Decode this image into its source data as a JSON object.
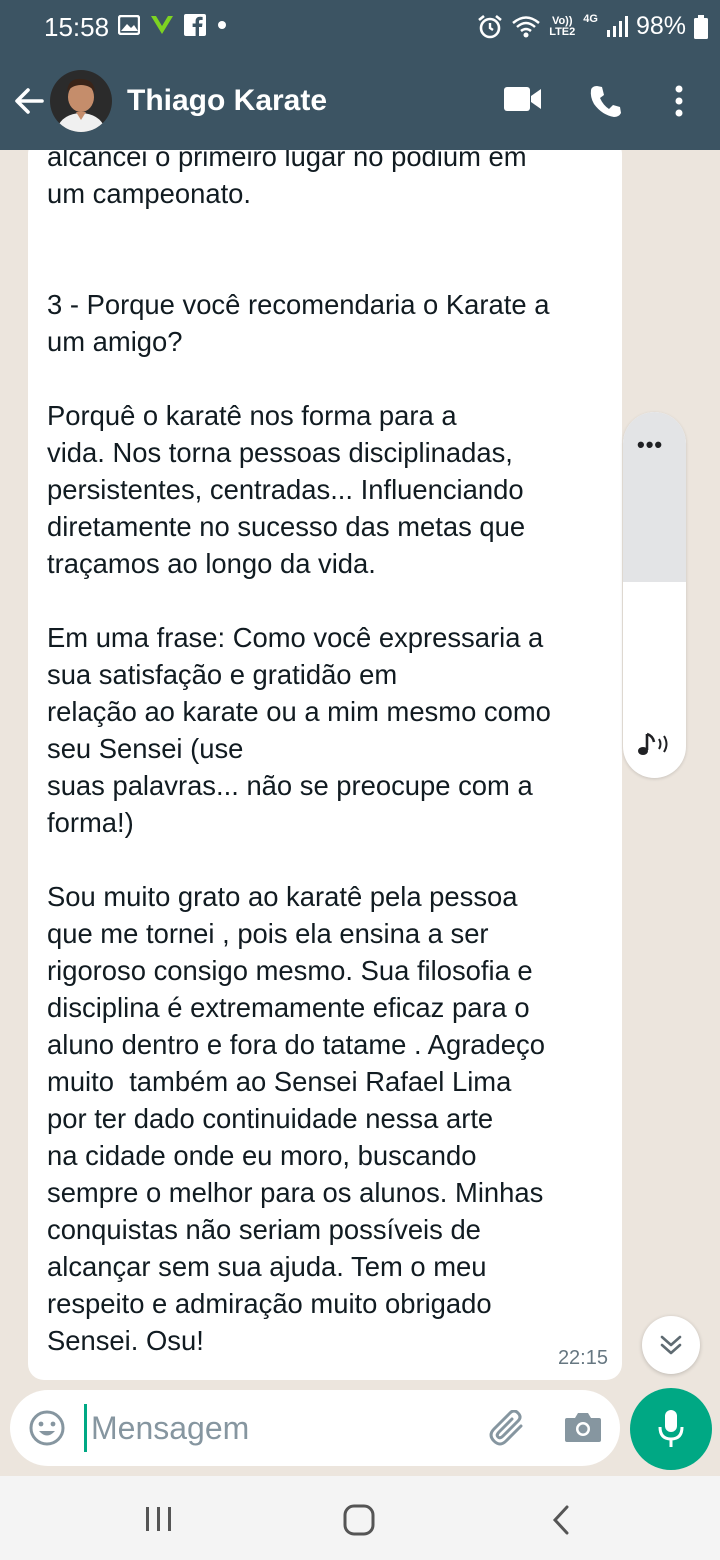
{
  "status_bar": {
    "time": "15:58",
    "left_icons": [
      "gallery-icon",
      "vivo-icon",
      "facebook-icon",
      "dot-icon"
    ],
    "network_label_top": "Vo))",
    "network_label_bottom": "LTE2",
    "network_type": "4G",
    "battery": "98%"
  },
  "header": {
    "contact_name": "Thiago Karate",
    "icons": [
      "back-arrow-icon",
      "video-call-icon",
      "phone-icon",
      "more-vert-icon"
    ]
  },
  "message": {
    "text": "alcancei o primeiro lugar no podium em\num campeonato.\n\n\n3 - Porque você recomendaria o Karate a\num amigo?\n\nPorquê o karatê nos forma para a\nvida. Nos torna pessoas disciplinadas,\npersistentes, centradas... Influenciando\ndiretamente no sucesso das metas que\ntraçamos ao longo da vida.\n\nEm uma frase: Como você expressaria a\nsua satisfação e gratidão em\nrelação ao karate ou a mim mesmo como\nseu Sensei (use\nsuas palavras... não se preocupe com a\nforma!)\n\nSou muito grato ao karatê pela pessoa\nque me tornei , pois ela ensina a ser\nrigoroso consigo mesmo. Sua filosofia e\ndisciplina é extremamente eficaz para o\naluno dentro e fora do tatame . Agradeço\nmuito  também ao Sensei Rafael Lima\npor ter dado continuidade nessa arte\nna cidade onde eu moro, buscando\nsempre o melhor para os alunos. Minhas\nconquistas não seriam possíveis de\nalcançar sem sua ajuda. Tem o meu\nrespeito e admiração muito obrigado\nSensei. Osu!",
    "time": "22:15"
  },
  "side_panel": {
    "dots": "•••",
    "icon": "sound-icon"
  },
  "input": {
    "placeholder": "Mensagem",
    "value": ""
  },
  "colors": {
    "header_bg": "#3c5463",
    "chat_bg": "#ece5dd",
    "accent": "#00a884",
    "bubble_bg": "#ffffff"
  }
}
